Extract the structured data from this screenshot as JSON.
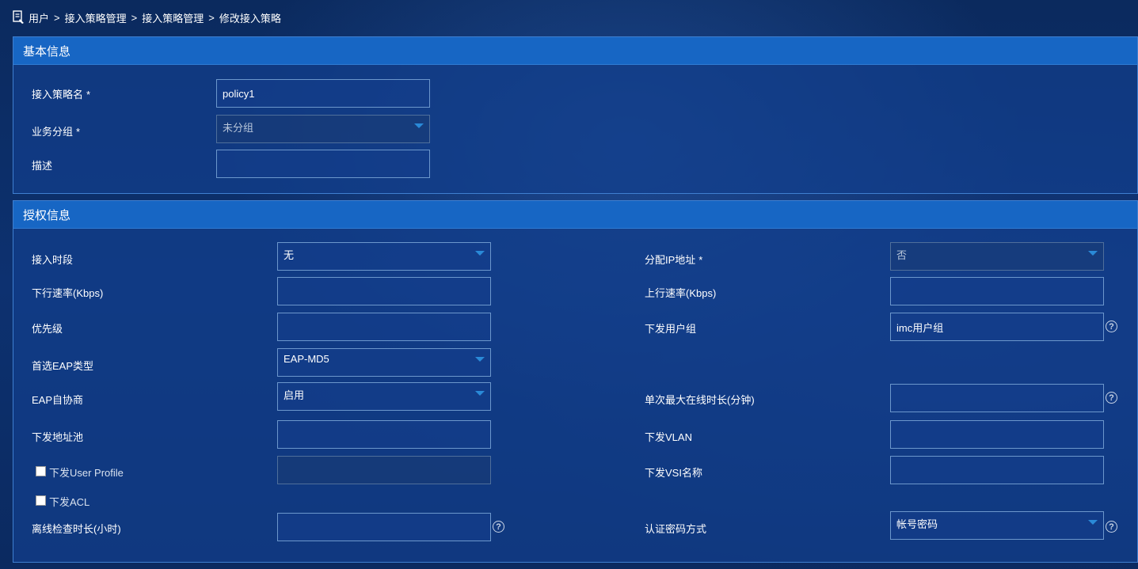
{
  "breadcrumb": {
    "items": [
      "用户",
      "接入策略管理",
      "接入策略管理",
      "修改接入策略"
    ],
    "separator": ">"
  },
  "basic": {
    "title": "基本信息",
    "policy_name_label": "接入策略名",
    "policy_name_value": "policy1",
    "group_label": "业务分组",
    "group_value": "未分组",
    "desc_label": "描述",
    "desc_value": "",
    "required_mark": "*"
  },
  "auth": {
    "title": "授权信息",
    "access_period_label": "接入时段",
    "access_period_value": "无",
    "assign_ip_label": "分配IP地址",
    "assign_ip_value": "否",
    "down_rate_label": "下行速率(Kbps)",
    "down_rate_value": "",
    "up_rate_label": "上行速率(Kbps)",
    "up_rate_value": "",
    "priority_label": "优先级",
    "priority_value": "",
    "user_group_label": "下发用户组",
    "user_group_value": "imc用户组",
    "eap_type_label": "首选EAP类型",
    "eap_type_value": "EAP-MD5",
    "eap_nego_label": "EAP自协商",
    "eap_nego_value": "启用",
    "max_online_label": "单次最大在线时长(分钟)",
    "max_online_value": "",
    "addr_pool_label": "下发地址池",
    "addr_pool_value": "",
    "vlan_label": "下发VLAN",
    "vlan_value": "",
    "user_profile_label": "下发User Profile",
    "user_profile_value": "",
    "vsi_label": "下发VSI名称",
    "vsi_value": "",
    "acl_label": "下发ACL",
    "offline_check_label": "离线检查时长(小时)",
    "offline_check_value": "",
    "pwd_method_label": "认证密码方式",
    "pwd_method_value": "帐号密码",
    "required_mark": "*"
  },
  "help_glyph": "?",
  "icons": {
    "home": "user-manage-icon",
    "help": "question-circle-icon",
    "caret": "caret-down-icon"
  },
  "colors": {
    "header_bar": "#1766c4",
    "panel_border": "#3f7fd0",
    "field_border": "#6c97cc",
    "caret": "#2a8ad8"
  }
}
